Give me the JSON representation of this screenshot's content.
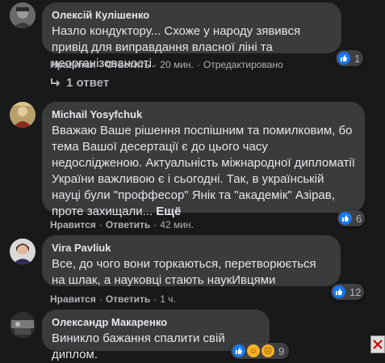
{
  "comments": [
    {
      "author": "Олексій Кулішенко",
      "text": "Назло кондуктору... Схоже у народу зявився привід для виправдання власної ліні та неорганізованості.",
      "like_label": "Нравится",
      "reply_label": "Ответить",
      "time": "20 мин.",
      "edited": "Отредактировано",
      "reaction_count": "1",
      "replies_label": "1 ответ"
    },
    {
      "author": "Michail Yosyfchuk",
      "text": "Вважаю Ваше рішення поспішним та помилковим, бо тема Вашої десертації є до цього часу недослідженою. Актуальність міжнародної дипломатії України важливою є і сьогодні. Так, в українській науці були \"проффесор\" Янік та \"академік\" Азірав, проте захищали...",
      "more_label": "Ещё",
      "like_label": "Нравится",
      "reply_label": "Ответить",
      "time": "42 мин.",
      "reaction_count": "6"
    },
    {
      "author": "Vira Pavliuk",
      "text": "Все, до чого вони торкаються, перетворюється на шлак, а науковці стають наукИвцями",
      "like_label": "Нравится",
      "reply_label": "Ответить",
      "time": "1 ч.",
      "reaction_count": "12"
    },
    {
      "author": "Олександр Макаренко",
      "text": "Виникло бажання спалити свій диплом.",
      "reaction_count": "9"
    }
  ],
  "colors": {
    "background": "#18191a",
    "bubble": "#3a3b3c",
    "like_blue": "#1877f2"
  }
}
